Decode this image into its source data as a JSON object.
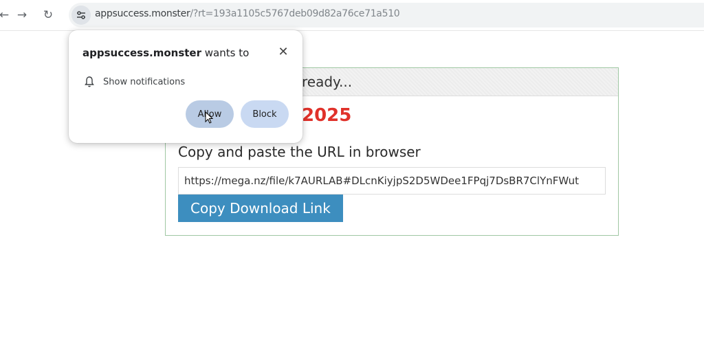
{
  "browser": {
    "nav": {
      "back": "←",
      "forward": "→",
      "reload": "↻"
    },
    "url_host": "appsuccess.monster",
    "url_rest": "/?rt=193a1105c5767deb09d82a76ce71a510"
  },
  "page": {
    "header_text": "ready...",
    "year_text": "2025",
    "copy_label": "Copy and paste the URL in browser",
    "download_url": "https://mega.nz/file/k7AURLAB#DLcnKiyjpS2D5WDee1FPqj7DsBR7ClYnFWut",
    "copy_button": "Copy Download Link"
  },
  "permission_popup": {
    "site": "appsuccess.monster",
    "title_suffix": " wants to",
    "close": "✕",
    "item": "Show notifications",
    "allow": "Allow",
    "block": "Block"
  },
  "colors": {
    "accent_button": "#3d8ebf",
    "year_red": "#e0312a",
    "box_border": "#9fc7a3"
  }
}
